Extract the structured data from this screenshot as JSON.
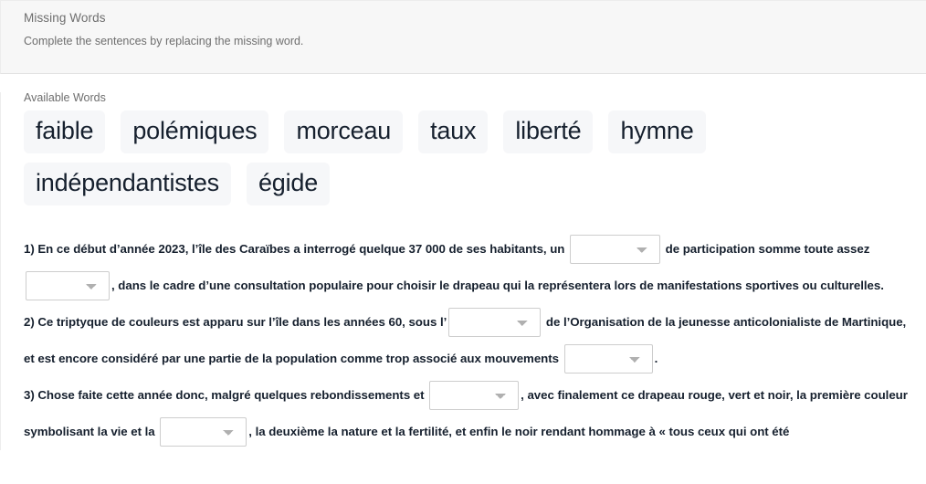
{
  "header": {
    "title": "Missing Words",
    "subtitle": "Complete the sentences by replacing the missing word."
  },
  "available_words": {
    "label": "Available Words",
    "words": [
      "faible",
      "polémiques",
      "morceau",
      "taux",
      "liberté",
      "hymne",
      "indépendantistes",
      "égide"
    ]
  },
  "blank": {
    "placeholder": ""
  },
  "sentences": [
    {
      "number": "1)",
      "parts": [
        {
          "type": "text",
          "value": "1) En ce début d’année 2023, l’île des Caraïbes a interrogé quelque 37 000 de ses habitants, un "
        },
        {
          "type": "blank",
          "name": "blank-1"
        },
        {
          "type": "text",
          "value": " de participation somme toute assez "
        },
        {
          "type": "blank",
          "name": "blank-2"
        },
        {
          "type": "text",
          "value": ", dans le cadre d’une consultation populaire pour choisir le drapeau qui la représentera lors de manifestations sportives ou culturelles."
        }
      ]
    },
    {
      "number": "2)",
      "parts": [
        {
          "type": "text",
          "value": "2) Ce triptyque de couleurs est apparu sur l’île dans les années 60, sous l’"
        },
        {
          "type": "blank",
          "name": "blank-3"
        },
        {
          "type": "text",
          "value": " de l’Organisation de la jeunesse anticolonialiste de Martinique, et est encore considéré par une partie de la population comme trop associé aux mouvements "
        },
        {
          "type": "blank",
          "name": "blank-4"
        },
        {
          "type": "text",
          "value": "."
        }
      ]
    },
    {
      "number": "3)",
      "parts": [
        {
          "type": "text",
          "value": "3) Chose faite cette année donc, malgré quelques rebondissements et "
        },
        {
          "type": "blank",
          "name": "blank-5"
        },
        {
          "type": "text",
          "value": ", avec finalement ce drapeau rouge, vert et noir, la première couleur symbolisant la vie et la "
        },
        {
          "type": "blank",
          "name": "blank-6"
        },
        {
          "type": "text",
          "value": ", la deuxième la nature et la fertilité, et enfin le noir rendant hommage à « tous ceux qui ont été"
        }
      ]
    }
  ],
  "colors": {
    "header_bg": "#f7f7f7",
    "chip_bg": "#f6f7f9",
    "text_dark": "#16202e",
    "text_muted": "#6e6e6e",
    "border": "#cdcdcd"
  }
}
